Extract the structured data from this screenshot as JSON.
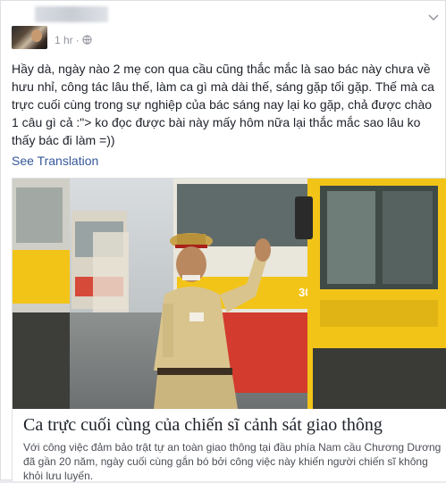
{
  "post": {
    "time": "1 hr",
    "dot": "·",
    "text": "Hầy dà, ngày nào 2 mẹ con qua cầu cũng thắc mắc là sao bác này chưa về hưu nhỉ, công tác lâu thế, làm ca gì mà dài thế, sáng gặp tối gặp. Thế mà ca trực cuối cùng trong sự nghiệp của bác sáng nay lại ko gặp, chả được chào 1 câu gì cả :\"> ko đọc được bài này mấy hôm nữa lại thắc mắc sao lâu ko thấy bác đi làm =))",
    "see_translation": "See Translation"
  },
  "link": {
    "title": "Ca trực cuối cùng của chiến sĩ cảnh sát giao thông",
    "description": "Với công việc đảm bảo trật tự an toàn giao thông tại đầu phía Nam cầu Chương Dương đã gần 20 năm, ngày cuối cùng gắn bó bởi công việc này khiến người chiến sĩ không khỏi lưu luyến.",
    "bus_number": "30K"
  },
  "colors": {
    "link_blue": "#365899",
    "meta_gray": "#90949c",
    "text_dark": "#1d2129",
    "bus_yellow": "#f2c418",
    "uniform_khaki": "#d9c48e"
  },
  "icons": {
    "privacy": "globe-icon",
    "menu": "chevron-down-icon"
  }
}
